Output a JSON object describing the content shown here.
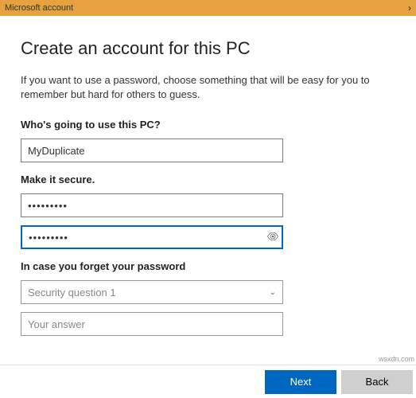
{
  "titlebar": {
    "title": "Microsoft account"
  },
  "main": {
    "heading": "Create an account for this PC",
    "description": "If you want to use a password, choose something that will be easy for you to remember but hard for others to guess.",
    "who_label": "Who's going to use this PC?",
    "username_value": "MyDuplicate",
    "secure_label": "Make it secure.",
    "password1_value": "•••••••••",
    "password2_value": "•••••••••",
    "forget_label": "In case you forget your password",
    "security_question_placeholder": "Security question 1",
    "answer_placeholder": "Your answer"
  },
  "footer": {
    "next_label": "Next",
    "back_label": "Back"
  },
  "watermark": "wsxdn.com"
}
